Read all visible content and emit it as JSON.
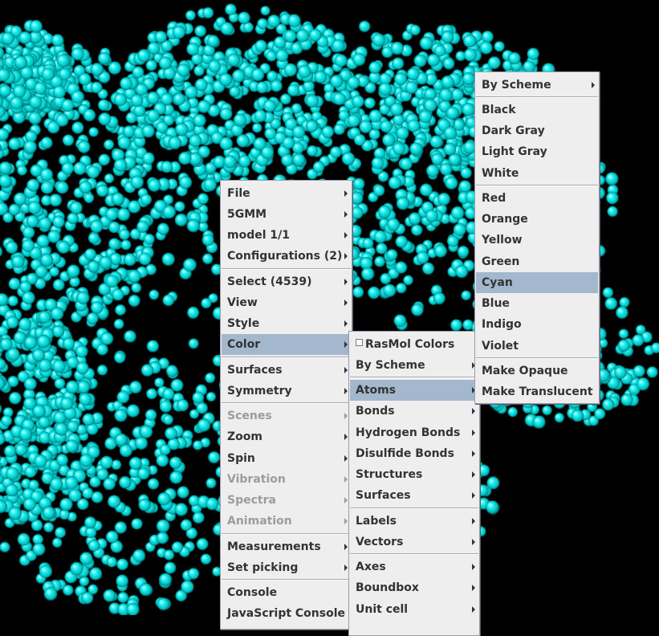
{
  "viewer": {
    "atom_color": "#00e5e5",
    "background": "#000000"
  },
  "menus": {
    "main": {
      "items": [
        {
          "label": "File",
          "sub": true
        },
        {
          "label": "5GMM",
          "sub": true
        },
        {
          "label": "model 1/1",
          "sub": true
        },
        {
          "label": "Configurations (2)",
          "sub": true
        },
        {
          "label": "Select (4539)",
          "sub": true
        },
        {
          "label": "View",
          "sub": true
        },
        {
          "label": "Style",
          "sub": true
        },
        {
          "label": "Color",
          "sub": true,
          "highlighted": true
        },
        {
          "label": "Surfaces",
          "sub": true
        },
        {
          "label": "Symmetry",
          "sub": true
        },
        {
          "label": "Scenes",
          "sub": true,
          "disabled": true
        },
        {
          "label": "Zoom",
          "sub": true
        },
        {
          "label": "Spin",
          "sub": true
        },
        {
          "label": "Vibration",
          "sub": true,
          "disabled": true
        },
        {
          "label": "Spectra",
          "sub": true,
          "disabled": true
        },
        {
          "label": "Animation",
          "sub": true,
          "disabled": true
        },
        {
          "label": "Measurements",
          "sub": true
        },
        {
          "label": "Set picking",
          "sub": true
        },
        {
          "label": "Console",
          "sub": false
        },
        {
          "label": "JavaScript Console",
          "sub": false
        }
      ]
    },
    "color": {
      "items": [
        {
          "label": "RasMol Colors",
          "checkbox": true,
          "checked": false
        },
        {
          "label": "By Scheme",
          "sub": true
        },
        {
          "label": "Atoms",
          "sub": true,
          "highlighted": true
        },
        {
          "label": "Bonds",
          "sub": true
        },
        {
          "label": "Hydrogen Bonds",
          "sub": true
        },
        {
          "label": "Disulfide Bonds",
          "sub": true
        },
        {
          "label": "Structures",
          "sub": true
        },
        {
          "label": "Surfaces",
          "sub": true
        },
        {
          "label": "Labels",
          "sub": true
        },
        {
          "label": "Vectors",
          "sub": true
        },
        {
          "label": "Axes",
          "sub": true
        },
        {
          "label": "Boundbox",
          "sub": true
        },
        {
          "label": "Unit cell",
          "sub": true
        }
      ]
    },
    "atoms": {
      "items": [
        {
          "label": "By Scheme",
          "sub": true
        },
        {
          "label": "Black"
        },
        {
          "label": "Dark Gray"
        },
        {
          "label": "Light Gray"
        },
        {
          "label": "White"
        },
        {
          "label": "Red"
        },
        {
          "label": "Orange"
        },
        {
          "label": "Yellow"
        },
        {
          "label": "Green"
        },
        {
          "label": "Cyan",
          "highlighted": true
        },
        {
          "label": "Blue"
        },
        {
          "label": "Indigo"
        },
        {
          "label": "Violet"
        },
        {
          "label": "Make Opaque"
        },
        {
          "label": "Make Translucent"
        }
      ]
    }
  }
}
